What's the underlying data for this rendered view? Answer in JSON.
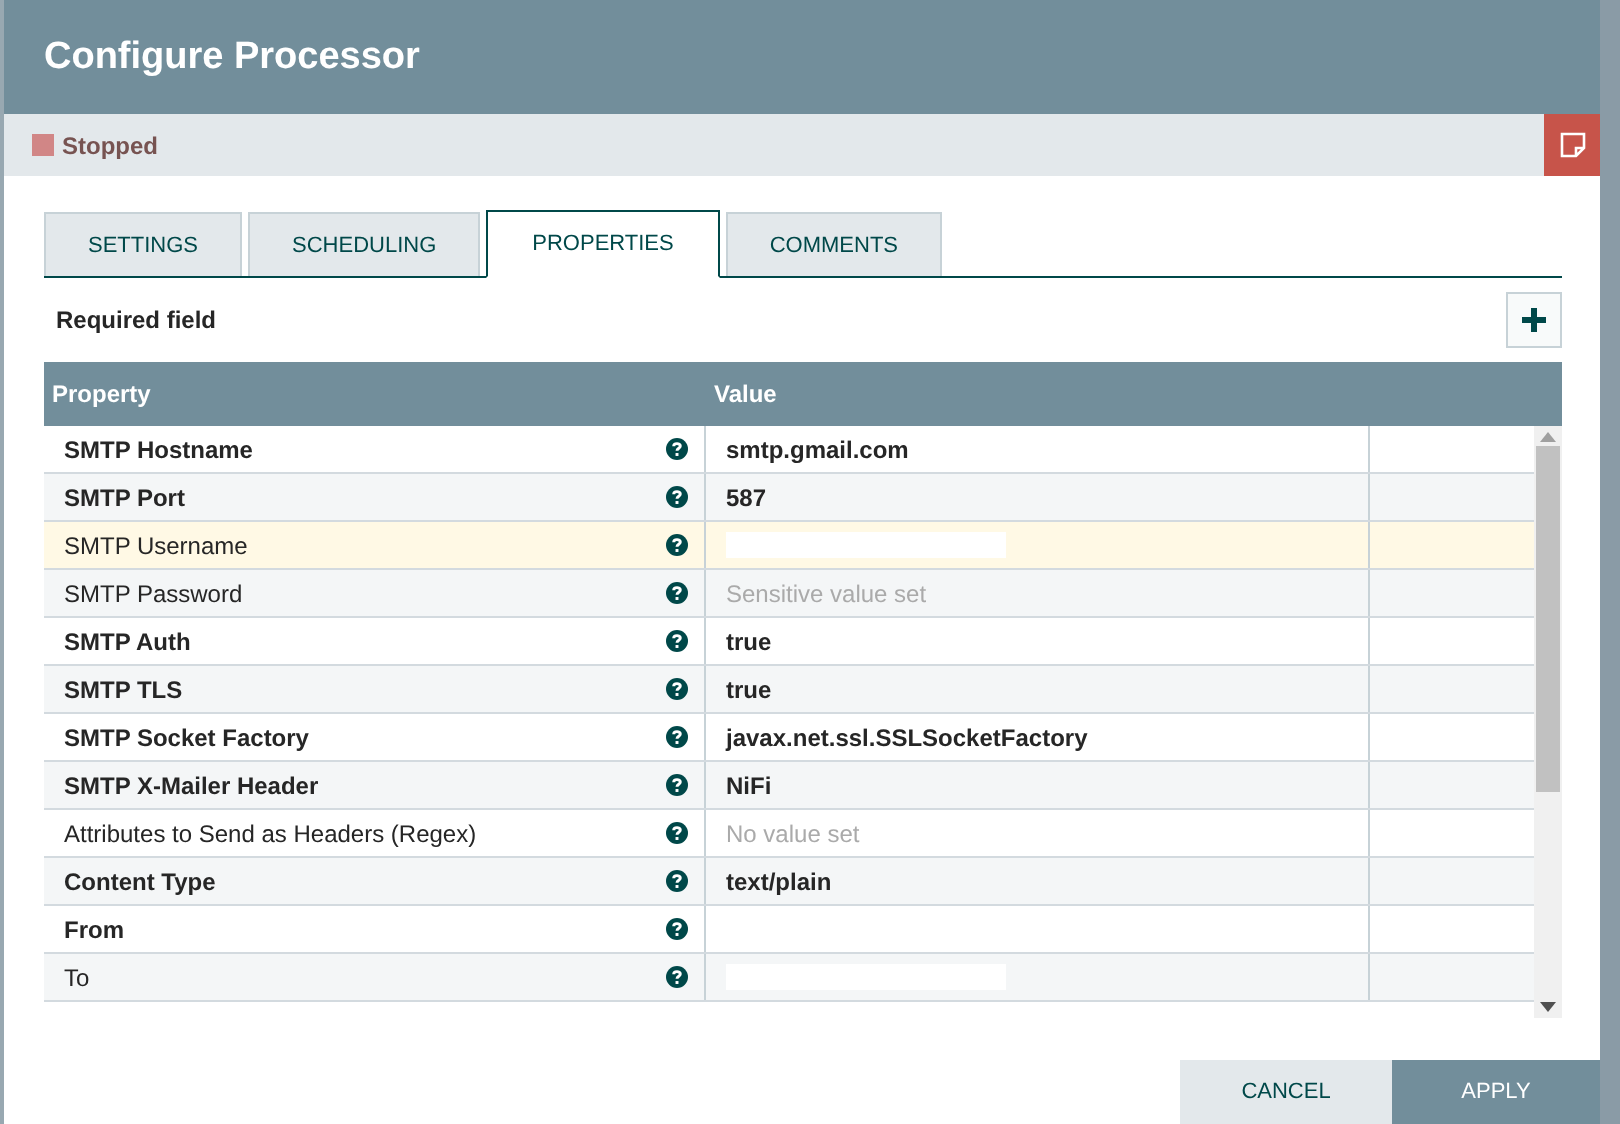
{
  "window": {
    "title": "Configure Processor"
  },
  "status": {
    "label": "Stopped",
    "color": "#d18686"
  },
  "tabs": [
    {
      "label": "SETTINGS",
      "selected": false
    },
    {
      "label": "SCHEDULING",
      "selected": false
    },
    {
      "label": "PROPERTIES",
      "selected": true
    },
    {
      "label": "COMMENTS",
      "selected": false
    }
  ],
  "required_note": "Required field",
  "table": {
    "columns": [
      "Property",
      "Value"
    ],
    "rows": [
      {
        "property": "SMTP Hostname",
        "required": true,
        "value": "smtp.gmail.com",
        "kind": "set",
        "selected": false
      },
      {
        "property": "SMTP Port",
        "required": true,
        "value": "587",
        "kind": "set",
        "selected": false
      },
      {
        "property": "SMTP Username",
        "required": false,
        "kind": "redacted",
        "selected": true
      },
      {
        "property": "SMTP Password",
        "required": false,
        "value": "Sensitive value set",
        "kind": "placeholder",
        "selected": false
      },
      {
        "property": "SMTP Auth",
        "required": true,
        "value": "true",
        "kind": "set",
        "selected": false
      },
      {
        "property": "SMTP TLS",
        "required": true,
        "value": "true",
        "kind": "set",
        "selected": false
      },
      {
        "property": "SMTP Socket Factory",
        "required": true,
        "value": "javax.net.ssl.SSLSocketFactory",
        "kind": "set",
        "selected": false
      },
      {
        "property": "SMTP X-Mailer Header",
        "required": true,
        "value": "NiFi",
        "kind": "set",
        "selected": false
      },
      {
        "property": "Attributes to Send as Headers (Regex)",
        "required": false,
        "value": "No value set",
        "kind": "placeholder",
        "selected": false
      },
      {
        "property": "Content Type",
        "required": true,
        "value": "text/plain",
        "kind": "set",
        "selected": false
      },
      {
        "property": "From",
        "required": true,
        "kind": "redacted",
        "selected": false
      },
      {
        "property": "To",
        "required": false,
        "kind": "redacted",
        "selected": false
      }
    ]
  },
  "buttons": [
    {
      "label": "CANCEL",
      "kind": "secondary"
    },
    {
      "label": "APPLY",
      "kind": "primary"
    }
  ]
}
